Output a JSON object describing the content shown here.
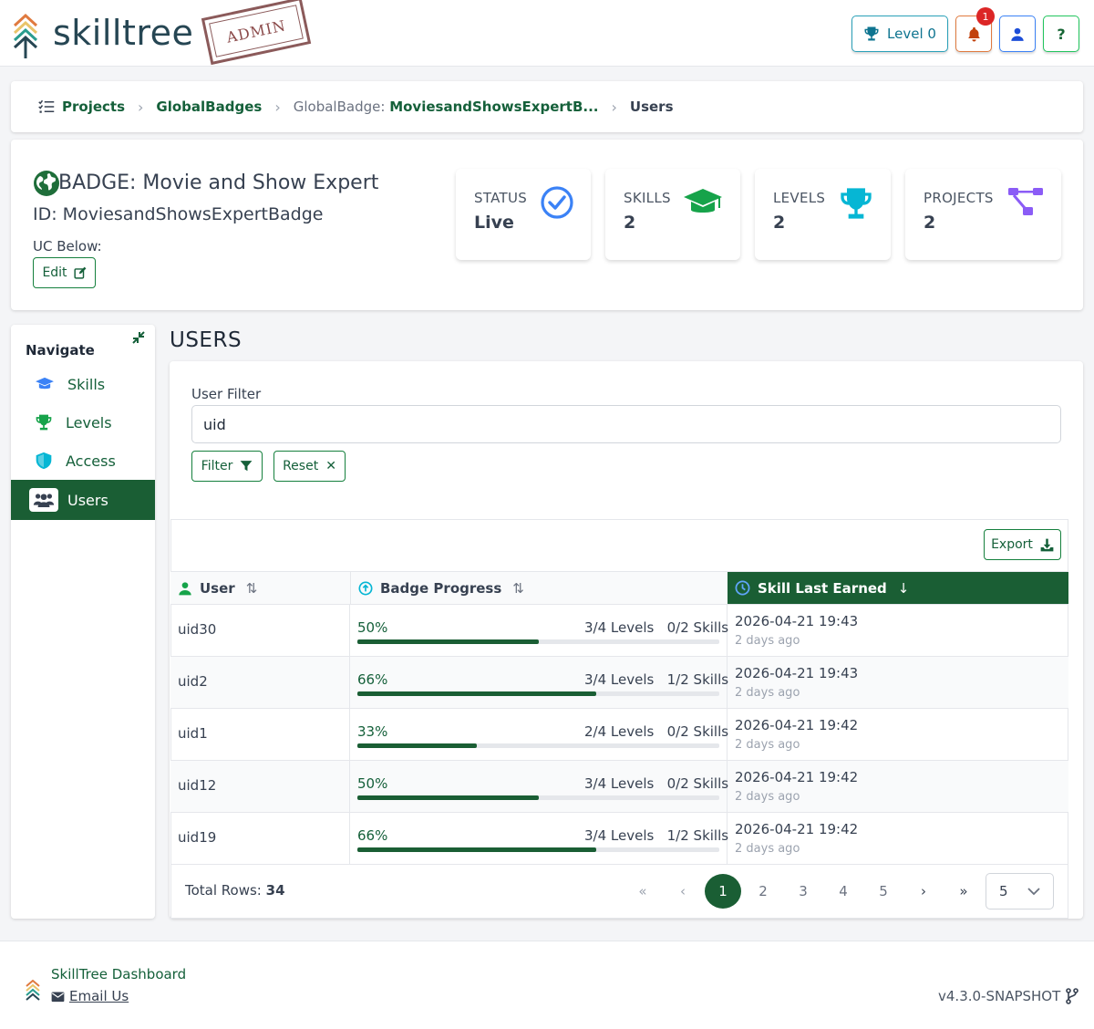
{
  "app": {
    "logo_text": "skilltree",
    "stamp_text": "ADMIN"
  },
  "header": {
    "level_label": "Level 0",
    "notification_count": "1",
    "help_label": "?"
  },
  "breadcrumb": {
    "projects": "Projects",
    "global_badges": "GlobalBadges",
    "global_badge_prefix": "GlobalBadge:",
    "global_badge_name": "MoviesandShowsExpertB...",
    "current": "Users"
  },
  "badge": {
    "title": "BADGE: Movie and Show Expert",
    "id_line": "ID: MoviesandShowsExpertBadge",
    "uc_label": "UC Below:",
    "edit_label": "Edit"
  },
  "stats": [
    {
      "label": "STATUS",
      "value": "Live",
      "icon": "check-circle-icon",
      "color": "#3b82f6"
    },
    {
      "label": "SKILLS",
      "value": "2",
      "icon": "graduation-cap-icon",
      "color": "#16a34a"
    },
    {
      "label": "LEVELS",
      "value": "2",
      "icon": "trophy-icon",
      "color": "#06b6d4"
    },
    {
      "label": "PROJECTS",
      "value": "2",
      "icon": "project-diagram-icon",
      "color": "#8b5cf6"
    }
  ],
  "nav": {
    "title": "Navigate",
    "items": [
      {
        "label": "Skills",
        "icon": "graduation-cap-icon"
      },
      {
        "label": "Levels",
        "icon": "trophy-icon"
      },
      {
        "label": "Access",
        "icon": "shield-icon"
      },
      {
        "label": "Users",
        "icon": "users-icon"
      }
    ]
  },
  "users": {
    "section_title": "USERS",
    "filter_label": "User Filter",
    "filter_value": "uid",
    "filter_button": "Filter",
    "reset_button": "Reset",
    "export_button": "Export",
    "columns": {
      "user": "User",
      "progress": "Badge Progress",
      "last_earned": "Skill Last Earned"
    },
    "rows": [
      {
        "user": "uid30",
        "percent": "50%",
        "progress": 0.5,
        "levels": "3/4 Levels",
        "skills": "0/2 Skills",
        "date": "2026-04-21 19:43",
        "ago": "2 days ago"
      },
      {
        "user": "uid2",
        "percent": "66%",
        "progress": 0.66,
        "levels": "3/4 Levels",
        "skills": "1/2 Skills",
        "date": "2026-04-21 19:43",
        "ago": "2 days ago"
      },
      {
        "user": "uid1",
        "percent": "33%",
        "progress": 0.33,
        "levels": "2/4 Levels",
        "skills": "0/2 Skills",
        "date": "2026-04-21 19:42",
        "ago": "2 days ago"
      },
      {
        "user": "uid12",
        "percent": "50%",
        "progress": 0.5,
        "levels": "3/4 Levels",
        "skills": "0/2 Skills",
        "date": "2026-04-21 19:42",
        "ago": "2 days ago"
      },
      {
        "user": "uid19",
        "percent": "66%",
        "progress": 0.66,
        "levels": "3/4 Levels",
        "skills": "1/2 Skills",
        "date": "2026-04-21 19:42",
        "ago": "2 days ago"
      }
    ],
    "total_label": "Total Rows:",
    "total_value": "34",
    "pages": [
      "1",
      "2",
      "3",
      "4",
      "5"
    ],
    "current_page": "1",
    "page_size": "5"
  },
  "footer": {
    "name": "SkillTree Dashboard",
    "email": "Email Us",
    "version": "v4.3.0-SNAPSHOT"
  },
  "colors": {
    "primary": "#1a5e34",
    "link": "#15603a"
  }
}
